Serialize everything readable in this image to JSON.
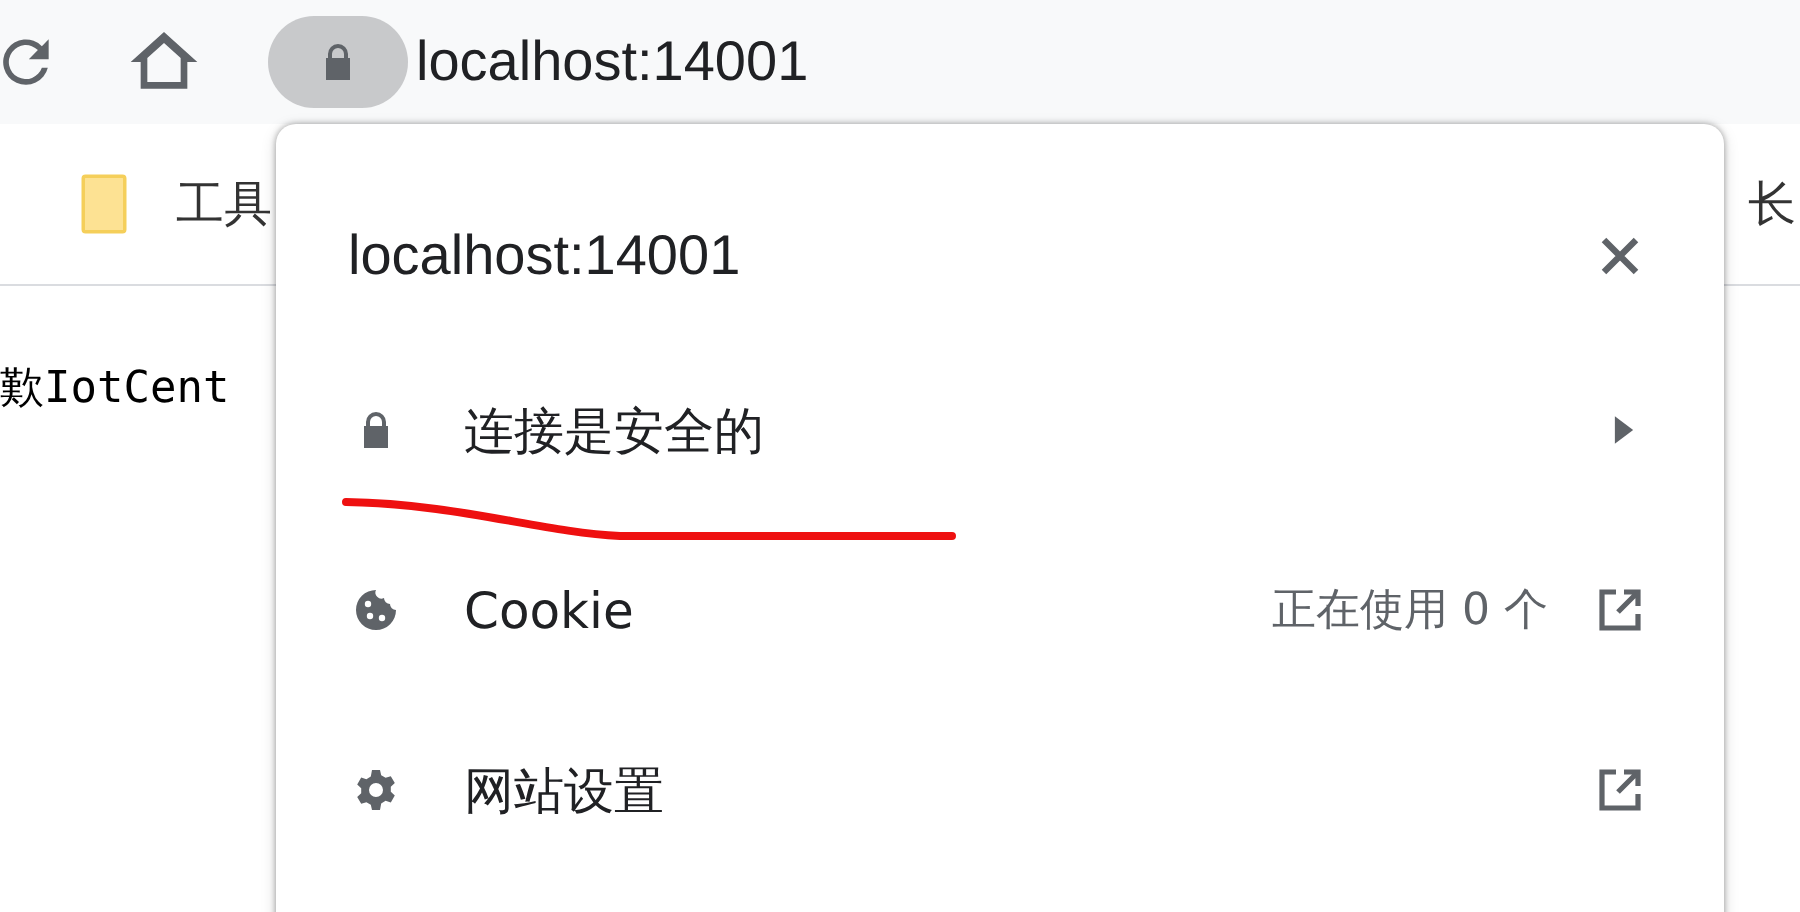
{
  "toolbar": {
    "address": "localhost:14001"
  },
  "bookmarks": [
    {
      "label": "工具"
    },
    {
      "label": "长"
    }
  ],
  "page": {
    "text": "歎IotCent"
  },
  "popup": {
    "title": "localhost:14001",
    "rows": [
      {
        "kind": "submenu",
        "label": "连接是安全的"
      },
      {
        "kind": "link",
        "label": "Cookie",
        "detail": "正在使用 0 个"
      },
      {
        "kind": "link",
        "label": "网站设置"
      }
    ]
  }
}
